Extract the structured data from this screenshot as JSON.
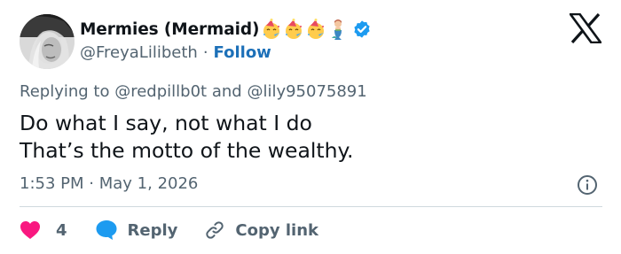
{
  "author": {
    "display_name": "Mermies (Mermaid)",
    "handle": "@FreyaLilibeth",
    "follow_label": "Follow",
    "emojis": [
      "party-face-emoji",
      "party-face-emoji",
      "party-face-emoji",
      "mermaid-emoji"
    ],
    "verified_color": "#1d9bf0"
  },
  "reply_context": {
    "prefix": "Replying to",
    "mention_1": "@redpillb0t",
    "connector": "and",
    "mention_2": "@lily95075891"
  },
  "tweet": {
    "line_1": "Do what I say, not what I do",
    "line_2": "That’s the motto of the wealthy."
  },
  "meta": {
    "time": "1:53 PM",
    "separator": "·",
    "date": "May 1, 2026"
  },
  "actions": {
    "like_count": "4",
    "like_color": "#f91880",
    "reply_label": "Reply",
    "reply_color": "#1d9bf0",
    "copy_link_label": "Copy link"
  },
  "icons": {
    "platform": "x-logo-icon",
    "info": "info-icon",
    "like": "heart-icon",
    "reply": "speech-bubble-icon",
    "copy": "link-icon"
  }
}
